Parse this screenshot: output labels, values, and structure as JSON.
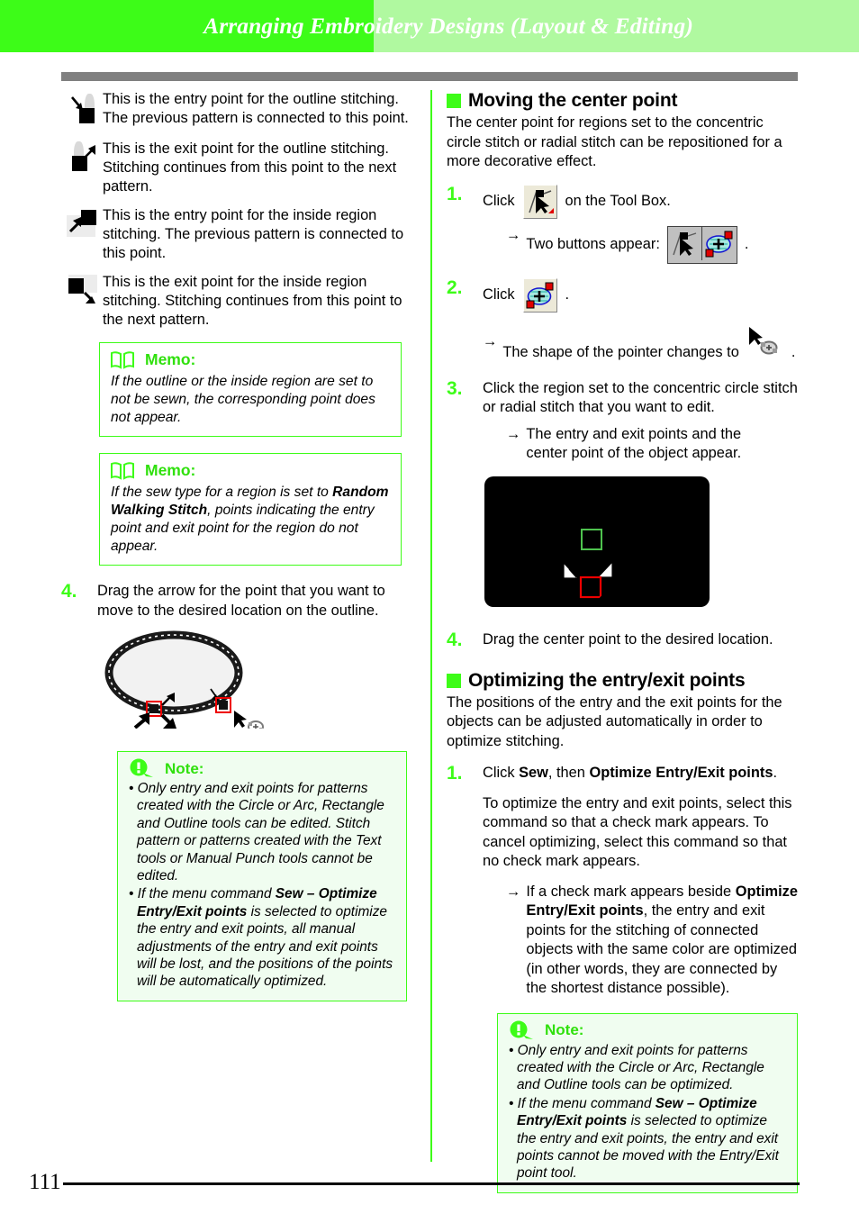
{
  "header": {
    "title": "Arranging Embroidery Designs (Layout & Editing)",
    "accent_bright": "#3dfc18",
    "accent_light": "#b0f9a0",
    "rule_color": "#808080"
  },
  "footer": {
    "page_number": "111"
  },
  "left_column": {
    "definitions": [
      {
        "icon": "entry-point-outline-icon",
        "text": "This is the entry point for the outline stitching. The previous pattern is connected to this point."
      },
      {
        "icon": "exit-point-outline-icon",
        "text": "This is the exit point for the outline stitching. Stitching continues from this point to the next pattern."
      },
      {
        "icon": "entry-point-region-icon",
        "text": "This is the entry point for the inside region stitching. The previous pattern is connected to this point."
      },
      {
        "icon": "exit-point-region-icon",
        "text": "This is the exit point for the inside region stitching. Stitching continues from this point to the next pattern."
      }
    ],
    "memo1": {
      "label": "Memo:",
      "body": "If the outline or the inside region are set to not be sewn, the corresponding point does not appear."
    },
    "memo2": {
      "label": "Memo:",
      "body_prefix": "If the sew type for a region is set to ",
      "body_bold": "Random Walking Stitch",
      "body_suffix": ", points indicating the entry point and exit point for the region do not appear."
    },
    "step4": {
      "number": "4.",
      "text": "Drag the arrow for the point that you want to move to the desired location on the outline."
    },
    "note": {
      "label": "Note:",
      "bullet1": "Only entry and exit points for patterns created with the Circle or Arc, Rectangle and Outline tools can be edited. Stitch pattern or patterns created with the Text tools or Manual Punch tools cannot be edited.",
      "bullet2_a": "If the menu command ",
      "bullet2_b": "Sew",
      "bullet2_c": " – ",
      "bullet2_d": "Optimize Entry/Exit points",
      "bullet2_e": " is selected to optimize the entry and exit points, all manual adjustments of the entry and exit points will be lost, and the positions of the points will be automatically optimized."
    }
  },
  "right_column": {
    "section1": {
      "title": "Moving the center point",
      "intro": "The center point for regions set to the concentric circle stitch or radial stitch can be repositioned for a more decorative effect.",
      "step1": {
        "number": "1.",
        "text_before": "Click",
        "text_after": "on the Tool Box.",
        "icon": "entry-exit-point-tool-icon",
        "arrow_text": "Two buttons appear:",
        "arrow_icon_1": "entry-exit-point-button-icon",
        "arrow_icon_2": "center-point-button-icon",
        "arrow_suffix": "."
      },
      "step2": {
        "number": "2.",
        "text_before": "Click",
        "icon": "center-point-tool-icon",
        "text_after": ".",
        "arrow_text": "The shape of the pointer changes to",
        "arrow_icon": "center-point-pointer-icon",
        "arrow_suffix": "."
      },
      "step3": {
        "number": "3.",
        "text": "Click the region set to the concentric circle stitch or radial stitch that you want to edit.",
        "arrow_text": "The entry and exit points and the center point of the object appear.",
        "figure": "design-canvas-entry-exit-center-points"
      },
      "step4": {
        "number": "4.",
        "text": "Drag the center point to the desired location."
      }
    },
    "section2": {
      "title": "Optimizing the entry/exit points",
      "intro": "The positions of the entry and the exit points for the objects can be adjusted automatically in order to optimize stitching.",
      "step1": {
        "number": "1.",
        "line_a": "Click ",
        "line_b": "Sew",
        "line_c": ", then ",
        "line_d": "Optimize Entry/Exit points",
        "line_e": ".",
        "paragraph": "To optimize the entry and exit points, select this command so that a check mark appears. To cancel optimizing, select this command so that no check mark appears.",
        "arrow_a": "If a check mark appears beside ",
        "arrow_b": "Optimize Entry/Exit points",
        "arrow_c": ", the entry and exit points for the stitching of connected objects with the same color are optimized (in other words, they are connected by the shortest distance possible)."
      },
      "note": {
        "label": "Note:",
        "bullet1": "Only entry and exit points for patterns created with the Circle or Arc, Rectangle and Outline tools can be optimized.",
        "bullet2_a": "If the menu command ",
        "bullet2_b": "Sew",
        "bullet2_c": " – ",
        "bullet2_d": "Optimize Entry/Exit points",
        "bullet2_e": " is selected to optimize the entry and exit points, the entry and exit points cannot be moved with the Entry/Exit point tool."
      }
    }
  }
}
